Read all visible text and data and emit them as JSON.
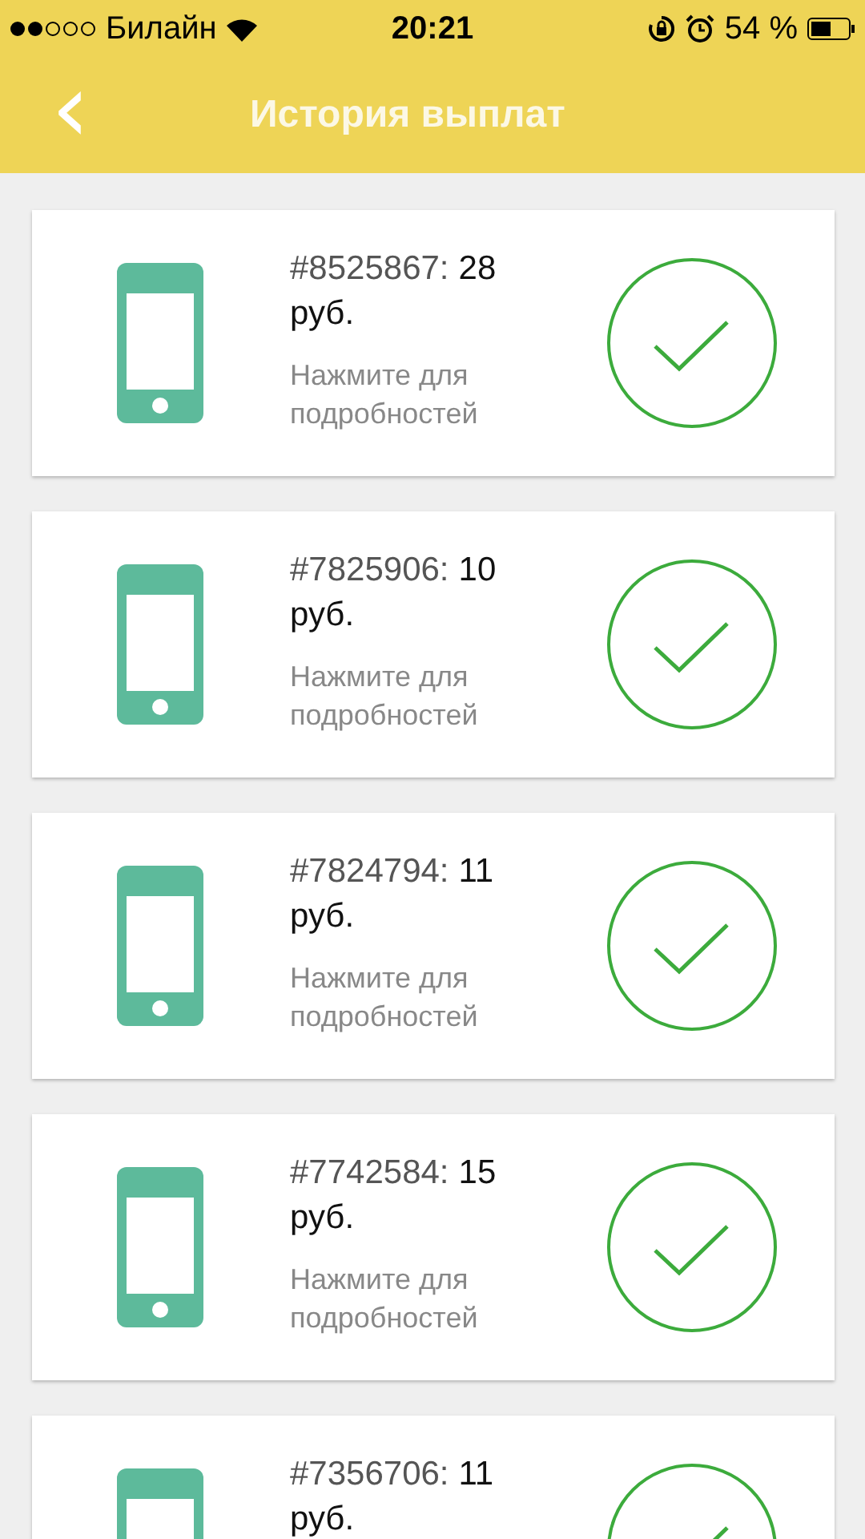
{
  "status_bar": {
    "carrier": "Билайн",
    "time": "20:21",
    "battery": "54 %"
  },
  "header": {
    "back": "‹",
    "title": "История выплат"
  },
  "payments": [
    {
      "number": "#8525867:",
      "amount": "28",
      "currency": "руб.",
      "hint": "Нажмите для подробностей",
      "paid": true
    },
    {
      "number": "#7825906:",
      "amount": "10",
      "currency": "руб.",
      "hint": "Нажмите для подробностей",
      "paid": true
    },
    {
      "number": "#7824794:",
      "amount": "11",
      "currency": "руб.",
      "hint": "Нажмите для подробностей",
      "paid": true
    },
    {
      "number": "#7742584:",
      "amount": "15",
      "currency": "руб.",
      "hint": "Нажмите для подробностей",
      "paid": true
    },
    {
      "number": "#7356706:",
      "amount": "11",
      "currency": "руб.",
      "paid": true
    }
  ]
}
